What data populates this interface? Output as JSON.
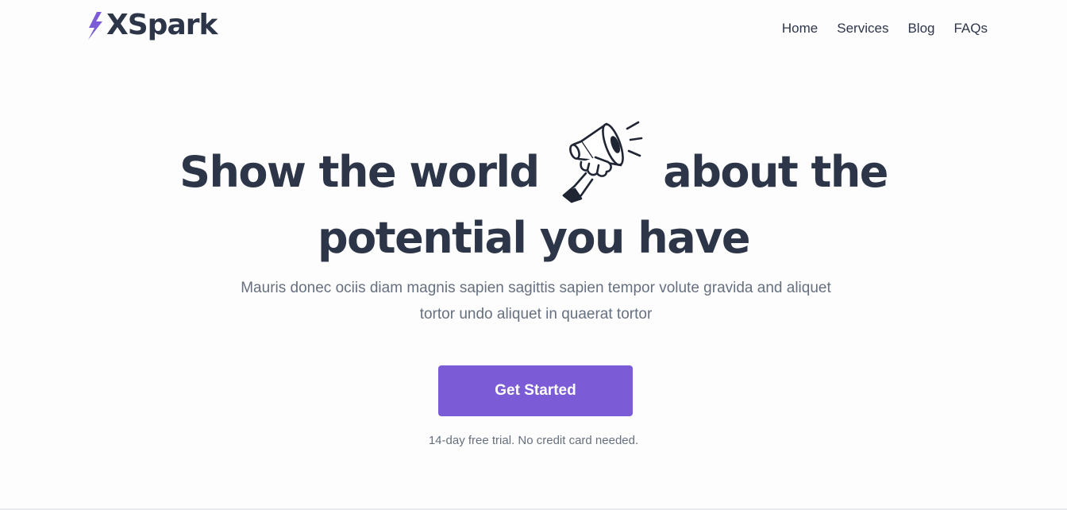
{
  "brand": {
    "name": "XSpark",
    "logo_icon": "lightning-bolt-icon",
    "accent_color": "#7b5cd6",
    "text_color": "#2d3648"
  },
  "nav": {
    "items": [
      {
        "label": "Home"
      },
      {
        "label": "Services"
      },
      {
        "label": "Blog"
      },
      {
        "label": "FAQs"
      }
    ]
  },
  "hero": {
    "headline_part1": "Show the world",
    "headline_icon": "megaphone-icon",
    "headline_part2": "about the",
    "headline_line2": "potential you have",
    "subtitle": "Mauris donec ociis diam magnis sapien sagittis sapien tempor volute gravida and aliquet tortor undo aliquet in quaerat tortor",
    "cta_label": "Get Started",
    "note": "14-day free trial. No credit card needed."
  }
}
